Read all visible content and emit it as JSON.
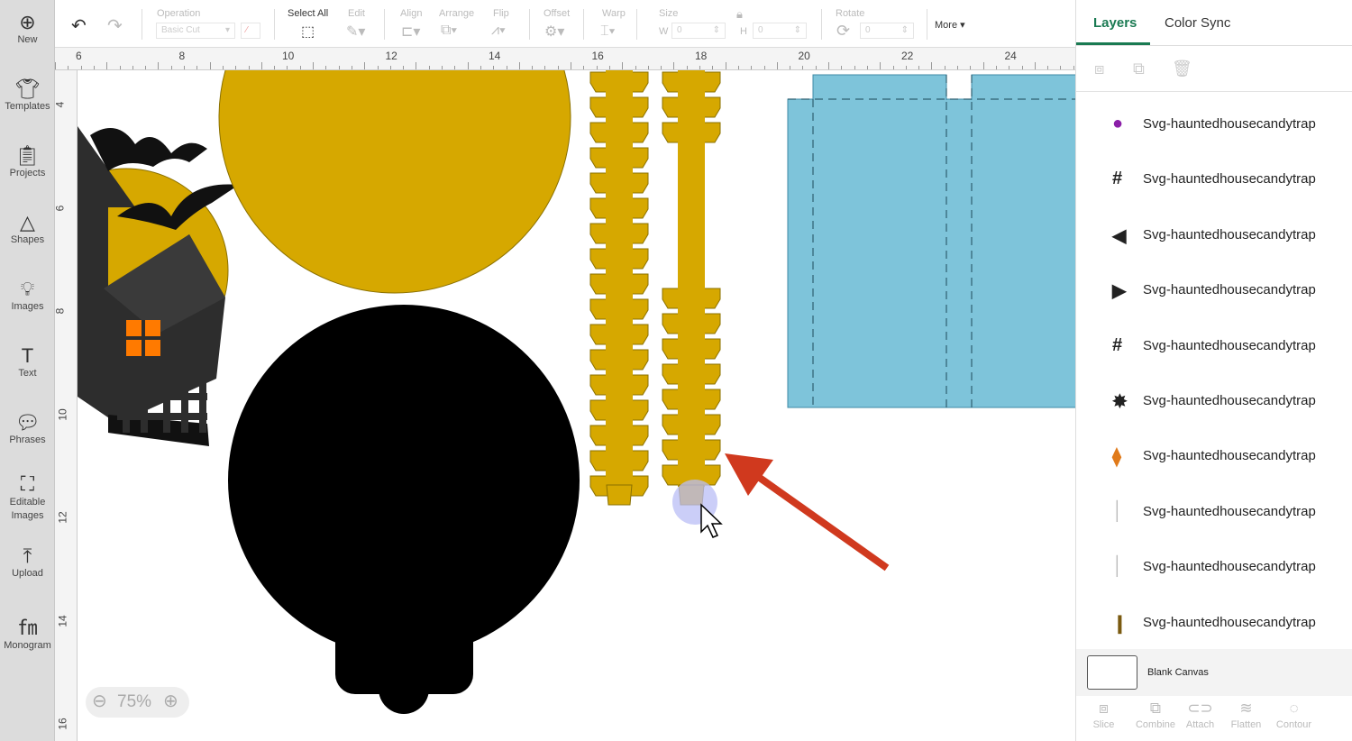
{
  "sidebar": {
    "items": [
      {
        "label": "New",
        "icon": "plus-circle-icon"
      },
      {
        "label": "Templates",
        "icon": "shirt-icon"
      },
      {
        "label": "Projects",
        "icon": "clipboard-icon"
      },
      {
        "label": "Shapes",
        "icon": "shapes-icon"
      },
      {
        "label": "Images",
        "icon": "bulb-icon"
      },
      {
        "label": "Text",
        "icon": "text-icon"
      },
      {
        "label": "Phrases",
        "icon": "speech-icon"
      },
      {
        "label": "Editable Images",
        "icon": "editable-icon"
      },
      {
        "label": "Upload",
        "icon": "upload-icon"
      },
      {
        "label": "Monogram",
        "icon": "monogram-icon"
      }
    ]
  },
  "toolbar": {
    "operation_label": "Operation",
    "operation_value": "Basic Cut",
    "select_all": "Select All",
    "edit": "Edit",
    "align": "Align",
    "arrange": "Arrange",
    "flip": "Flip",
    "offset": "Offset",
    "warp": "Warp",
    "size": "Size",
    "w_label": "W",
    "w_value": "0",
    "h_label": "H",
    "h_value": "0",
    "rotate": "Rotate",
    "rotate_value": "0",
    "more": "More"
  },
  "ruler": {
    "h": [
      "6",
      "8",
      "10",
      "12",
      "14",
      "16",
      "18",
      "20",
      "22",
      "24"
    ],
    "v": [
      "4",
      "6",
      "8",
      "10",
      "12",
      "14",
      "16"
    ]
  },
  "zoom": {
    "value": "75%"
  },
  "panel": {
    "tabs": [
      "Layers",
      "Color Sync"
    ],
    "active_tab": "Layers",
    "layers": [
      {
        "name": "Svg-hauntedhousecandytrap",
        "icon": "candy-icon",
        "color": "#8b1fa8"
      },
      {
        "name": "Svg-hauntedhousecandytrap",
        "icon": "fence-icon",
        "color": "#222"
      },
      {
        "name": "Svg-hauntedhousecandytrap",
        "icon": "triangle-left-icon",
        "color": "#222"
      },
      {
        "name": "Svg-hauntedhousecandytrap",
        "icon": "triangle-right-icon",
        "color": "#222"
      },
      {
        "name": "Svg-hauntedhousecandytrap",
        "icon": "fence-icon",
        "color": "#222"
      },
      {
        "name": "Svg-hauntedhousecandytrap",
        "icon": "tree-icon",
        "color": "#222"
      },
      {
        "name": "Svg-hauntedhousecandytrap",
        "icon": "candy-corn-icon",
        "color": "#e07a1a"
      },
      {
        "name": "Svg-hauntedhousecandytrap",
        "icon": "line-icon",
        "color": "#bbb"
      },
      {
        "name": "Svg-hauntedhousecandytrap",
        "icon": "line-icon",
        "color": "#bbb"
      },
      {
        "name": "Svg-hauntedhousecandytrap",
        "icon": "stick-icon",
        "color": "#7a5a10"
      }
    ],
    "blank_canvas": "Blank Canvas",
    "actions": [
      "Slice",
      "Combine",
      "Attach",
      "Flatten",
      "Contour"
    ]
  },
  "colors": {
    "accent": "#1a7a52",
    "yellow": "#d6a800",
    "blue": "#7ec4da",
    "arrow": "#d0391e"
  }
}
